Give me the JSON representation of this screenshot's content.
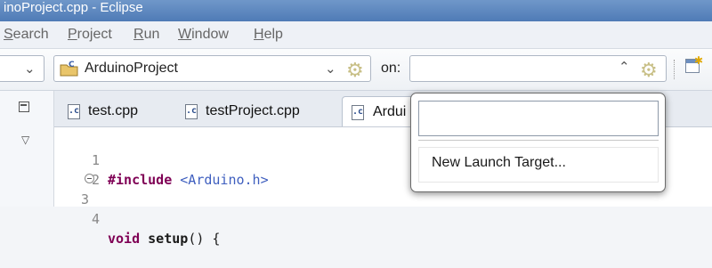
{
  "window": {
    "title": "inoProject.cpp - Eclipse"
  },
  "menu": {
    "items": [
      {
        "label": "Search",
        "mnemonic": "S"
      },
      {
        "label": "Project",
        "mnemonic": "P"
      },
      {
        "label": "Run",
        "mnemonic": "R"
      },
      {
        "label": "Window",
        "mnemonic": "W"
      },
      {
        "label": "Help",
        "mnemonic": "H"
      }
    ]
  },
  "toolbar": {
    "project_combo": {
      "value": "ArduinoProject"
    },
    "on_label": "on:",
    "target_combo": {
      "value": ""
    }
  },
  "tabs": [
    {
      "label": "test.cpp",
      "icon": "c-file-icon"
    },
    {
      "label": "testProject.cpp",
      "icon": "c-file-icon"
    },
    {
      "label": "Ardui",
      "icon": "c-file-icon",
      "active": true
    }
  ],
  "editor": {
    "lines": [
      {
        "num": "1",
        "text": "#include <Arduino.h>"
      },
      {
        "num": "2",
        "text": ""
      },
      {
        "num": "3",
        "text": "void setup() {"
      },
      {
        "num": "4",
        "text": ""
      }
    ]
  },
  "target_popup": {
    "filter_value": "",
    "items": [
      {
        "label": "New Launch Target..."
      }
    ]
  },
  "colors": {
    "titlebar": "#5a84bd",
    "keyword": "#7f0055",
    "include_path": "#3f5fbf"
  }
}
